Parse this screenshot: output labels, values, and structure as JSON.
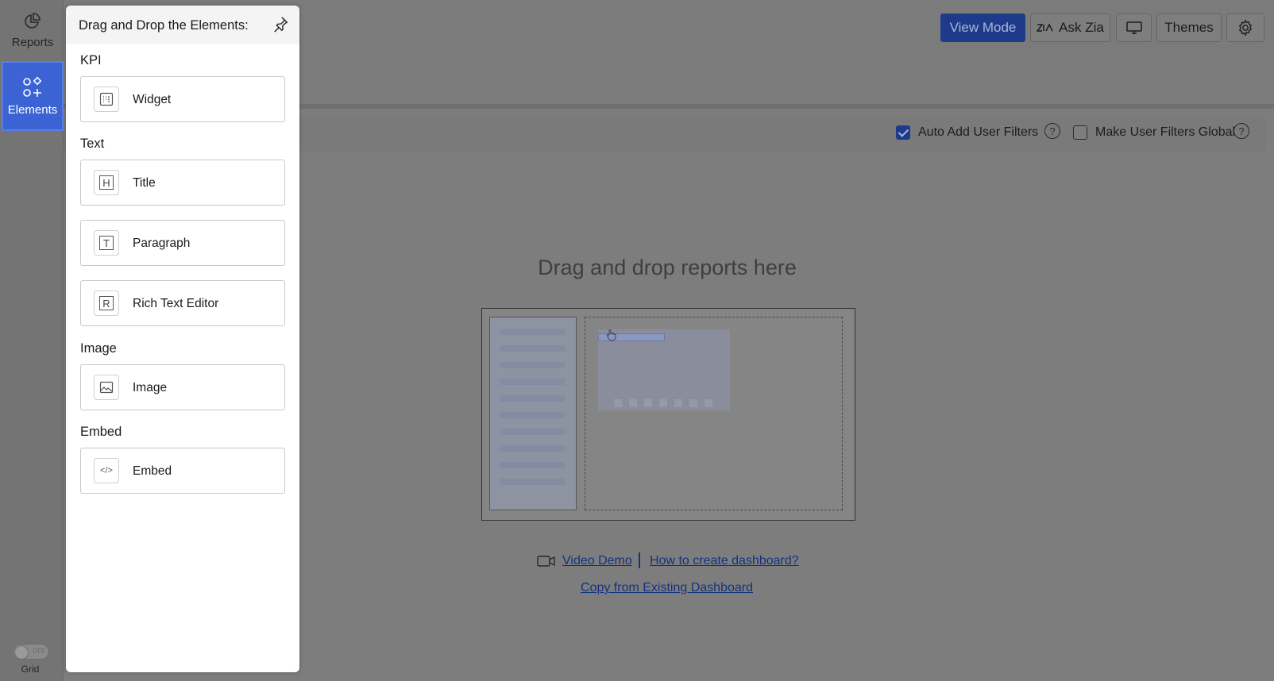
{
  "rail": {
    "reports_label": "Reports",
    "elements_label": "Elements",
    "grid_label": "Grid",
    "grid_state": "OFF"
  },
  "toolbar": {
    "view_mode_label": "View Mode",
    "ask_zia_label": "Ask Zia",
    "themes_label": "Themes",
    "icons": [
      "zia-icon",
      "monitor-icon",
      "gear-icon"
    ]
  },
  "filters": {
    "auto_add_label": "Auto Add User Filters",
    "auto_add_checked": true,
    "make_global_label": "Make User Filters Global",
    "make_global_checked": false,
    "help_glyph": "?"
  },
  "drop_area": {
    "title": "Drag and drop reports here",
    "video_demo_link": "Video Demo",
    "how_to_link": "How to create dashboard?",
    "copy_link": "Copy from Existing Dashboard"
  },
  "panel": {
    "title": "Drag and Drop the Elements:",
    "sections": {
      "kpi": "KPI",
      "text": "Text",
      "image": "Image",
      "embed": "Embed"
    },
    "items": {
      "widget": "Widget",
      "title": "Title",
      "paragraph": "Paragraph",
      "rich_text": "Rich Text Editor",
      "image": "Image",
      "embed": "Embed"
    },
    "icon_glyphs": {
      "title": "H",
      "paragraph": "T",
      "rich_text": "R",
      "embed": "</>"
    }
  },
  "colors": {
    "accent": "#3b63d4",
    "view_mode": "#1e3a8a",
    "link": "#12337f",
    "overlay": "#7d7d7d"
  }
}
